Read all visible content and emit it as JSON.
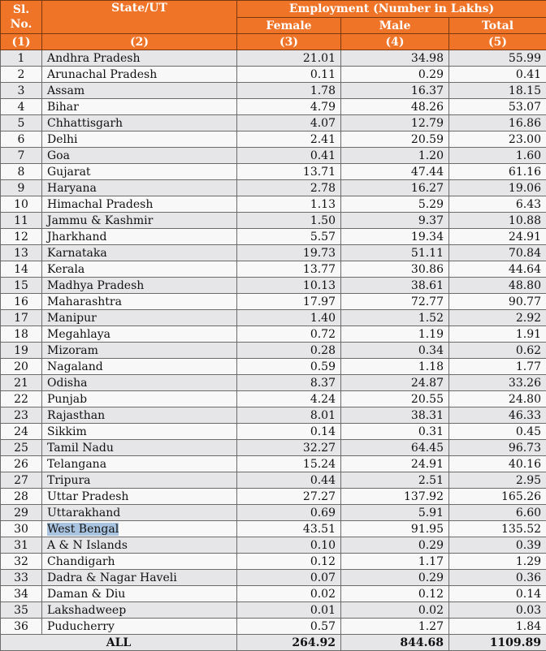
{
  "table": {
    "headers": {
      "sl": "Sl. No.",
      "sl_line1": "Sl.",
      "sl_line2": "No.",
      "state": "State/UT",
      "group": "Employment (Number in Lakhs)",
      "female": "Female",
      "male": "Male",
      "total": "Total",
      "index": [
        "(1)",
        "(2)",
        "(3)",
        "(4)",
        "(5)"
      ]
    },
    "highlighted_row": "West Bengal",
    "rows": [
      {
        "sl": "1",
        "state": "Andhra Pradesh",
        "female": "21.01",
        "male": "34.98",
        "total": "55.99"
      },
      {
        "sl": "2",
        "state": "Arunachal Pradesh",
        "female": "0.11",
        "male": "0.29",
        "total": "0.41"
      },
      {
        "sl": "3",
        "state": "Assam",
        "female": "1.78",
        "male": "16.37",
        "total": "18.15"
      },
      {
        "sl": "4",
        "state": "Bihar",
        "female": "4.79",
        "male": "48.26",
        "total": "53.07"
      },
      {
        "sl": "5",
        "state": "Chhattisgarh",
        "female": "4.07",
        "male": "12.79",
        "total": "16.86"
      },
      {
        "sl": "6",
        "state": "Delhi",
        "female": "2.41",
        "male": "20.59",
        "total": "23.00"
      },
      {
        "sl": "7",
        "state": "Goa",
        "female": "0.41",
        "male": "1.20",
        "total": "1.60"
      },
      {
        "sl": "8",
        "state": "Gujarat",
        "female": "13.71",
        "male": "47.44",
        "total": "61.16"
      },
      {
        "sl": "9",
        "state": "Haryana",
        "female": "2.78",
        "male": "16.27",
        "total": "19.06"
      },
      {
        "sl": "10",
        "state": "Himachal Pradesh",
        "female": "1.13",
        "male": "5.29",
        "total": "6.43"
      },
      {
        "sl": "11",
        "state": "Jammu & Kashmir",
        "female": "1.50",
        "male": "9.37",
        "total": "10.88"
      },
      {
        "sl": "12",
        "state": "Jharkhand",
        "female": "5.57",
        "male": "19.34",
        "total": "24.91"
      },
      {
        "sl": "13",
        "state": "Karnataka",
        "female": "19.73",
        "male": "51.11",
        "total": "70.84"
      },
      {
        "sl": "14",
        "state": "Kerala",
        "female": "13.77",
        "male": "30.86",
        "total": "44.64"
      },
      {
        "sl": "15",
        "state": "Madhya Pradesh",
        "female": "10.13",
        "male": "38.61",
        "total": "48.80"
      },
      {
        "sl": "16",
        "state": "Maharashtra",
        "female": "17.97",
        "male": "72.77",
        "total": "90.77"
      },
      {
        "sl": "17",
        "state": "Manipur",
        "female": "1.40",
        "male": "1.52",
        "total": "2.92"
      },
      {
        "sl": "18",
        "state": "Megahlaya",
        "female": "0.72",
        "male": "1.19",
        "total": "1.91"
      },
      {
        "sl": "19",
        "state": "Mizoram",
        "female": "0.28",
        "male": "0.34",
        "total": "0.62"
      },
      {
        "sl": "20",
        "state": "Nagaland",
        "female": "0.59",
        "male": "1.18",
        "total": "1.77"
      },
      {
        "sl": "21",
        "state": "Odisha",
        "female": "8.37",
        "male": "24.87",
        "total": "33.26"
      },
      {
        "sl": "22",
        "state": "Punjab",
        "female": "4.24",
        "male": "20.55",
        "total": "24.80"
      },
      {
        "sl": "23",
        "state": "Rajasthan",
        "female": "8.01",
        "male": "38.31",
        "total": "46.33"
      },
      {
        "sl": "24",
        "state": "Sikkim",
        "female": "0.14",
        "male": "0.31",
        "total": "0.45"
      },
      {
        "sl": "25",
        "state": "Tamil Nadu",
        "female": "32.27",
        "male": "64.45",
        "total": "96.73"
      },
      {
        "sl": "26",
        "state": "Telangana",
        "female": "15.24",
        "male": "24.91",
        "total": "40.16"
      },
      {
        "sl": "27",
        "state": "Tripura",
        "female": "0.44",
        "male": "2.51",
        "total": "2.95"
      },
      {
        "sl": "28",
        "state": "Uttar Pradesh",
        "female": "27.27",
        "male": "137.92",
        "total": "165.26"
      },
      {
        "sl": "29",
        "state": "Uttarakhand",
        "female": "0.69",
        "male": "5.91",
        "total": "6.60"
      },
      {
        "sl": "30",
        "state": "West Bengal",
        "female": "43.51",
        "male": "91.95",
        "total": "135.52"
      },
      {
        "sl": "31",
        "state": "A & N Islands",
        "female": "0.10",
        "male": "0.29",
        "total": "0.39"
      },
      {
        "sl": "32",
        "state": "Chandigarh",
        "female": "0.12",
        "male": "1.17",
        "total": "1.29"
      },
      {
        "sl": "33",
        "state": "Dadra & Nagar Haveli",
        "female": "0.07",
        "male": "0.29",
        "total": "0.36"
      },
      {
        "sl": "34",
        "state": "Daman & Diu",
        "female": "0.02",
        "male": "0.12",
        "total": "0.14"
      },
      {
        "sl": "35",
        "state": "Lakshadweep",
        "female": "0.01",
        "male": "0.02",
        "total": "0.03"
      },
      {
        "sl": "36",
        "state": "Puducherry",
        "female": "0.57",
        "male": "1.27",
        "total": "1.84"
      }
    ],
    "footer": {
      "label": "ALL",
      "female": "264.92",
      "male": "844.68",
      "total": "1109.89"
    }
  },
  "colors": {
    "header_bg": "#f07428",
    "header_text": "#ffffff",
    "row_odd": "#e6e6e8",
    "row_even": "#f8f8f8",
    "selection_highlight": "#a9c4e0"
  }
}
